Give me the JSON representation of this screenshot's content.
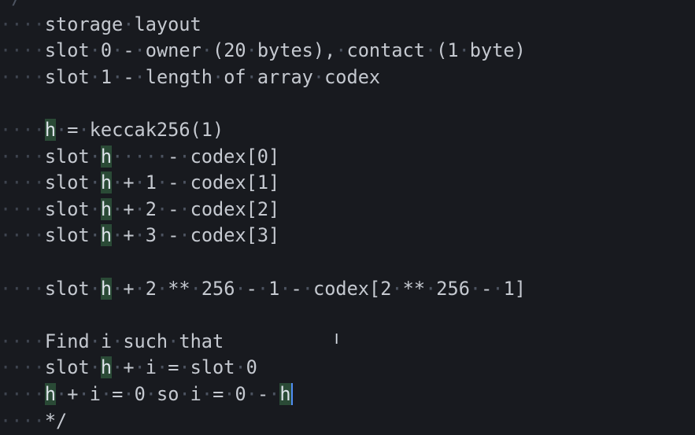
{
  "editor": {
    "lines": [
      {
        "id": "top",
        "indent": "",
        "segments": [
          {
            "t": " ",
            "k": "code"
          },
          {
            "t": "/",
            "k": "ws"
          }
        ]
      },
      {
        "id": "l1",
        "indent": "····",
        "segments": [
          {
            "t": "storage",
            "k": "code"
          },
          {
            "t": "·",
            "k": "ws"
          },
          {
            "t": "layout",
            "k": "code"
          }
        ]
      },
      {
        "id": "l2",
        "indent": "····",
        "segments": [
          {
            "t": "slot",
            "k": "code"
          },
          {
            "t": "·",
            "k": "ws"
          },
          {
            "t": "0",
            "k": "code"
          },
          {
            "t": "·",
            "k": "ws"
          },
          {
            "t": "-",
            "k": "code"
          },
          {
            "t": "·",
            "k": "ws"
          },
          {
            "t": "owner",
            "k": "code"
          },
          {
            "t": "·",
            "k": "ws"
          },
          {
            "t": "(20",
            "k": "code"
          },
          {
            "t": "·",
            "k": "ws"
          },
          {
            "t": "bytes),",
            "k": "code"
          },
          {
            "t": "·",
            "k": "ws"
          },
          {
            "t": "contact",
            "k": "code"
          },
          {
            "t": "·",
            "k": "ws"
          },
          {
            "t": "(1",
            "k": "code"
          },
          {
            "t": "·",
            "k": "ws"
          },
          {
            "t": "byte)",
            "k": "code"
          }
        ]
      },
      {
        "id": "l3",
        "indent": "····",
        "segments": [
          {
            "t": "slot",
            "k": "code"
          },
          {
            "t": "·",
            "k": "ws"
          },
          {
            "t": "1",
            "k": "code"
          },
          {
            "t": "·",
            "k": "ws"
          },
          {
            "t": "-",
            "k": "code"
          },
          {
            "t": "·",
            "k": "ws"
          },
          {
            "t": "length",
            "k": "code"
          },
          {
            "t": "·",
            "k": "ws"
          },
          {
            "t": "of",
            "k": "code"
          },
          {
            "t": "·",
            "k": "ws"
          },
          {
            "t": "array",
            "k": "code"
          },
          {
            "t": "·",
            "k": "ws"
          },
          {
            "t": "codex",
            "k": "code"
          }
        ]
      },
      {
        "id": "blank1",
        "indent": "",
        "segments": []
      },
      {
        "id": "l5",
        "indent": "····",
        "segments": [
          {
            "t": "h",
            "k": "hl"
          },
          {
            "t": "·",
            "k": "ws"
          },
          {
            "t": "=",
            "k": "code"
          },
          {
            "t": "·",
            "k": "ws"
          },
          {
            "t": "keccak256(1)",
            "k": "code"
          }
        ]
      },
      {
        "id": "l6",
        "indent": "····",
        "segments": [
          {
            "t": "slot",
            "k": "code"
          },
          {
            "t": "·",
            "k": "ws"
          },
          {
            "t": "h",
            "k": "hl"
          },
          {
            "t": "·····",
            "k": "ws"
          },
          {
            "t": "-",
            "k": "code"
          },
          {
            "t": "·",
            "k": "ws"
          },
          {
            "t": "codex[0]",
            "k": "code"
          }
        ]
      },
      {
        "id": "l7",
        "indent": "····",
        "segments": [
          {
            "t": "slot",
            "k": "code"
          },
          {
            "t": "·",
            "k": "ws"
          },
          {
            "t": "h",
            "k": "hl"
          },
          {
            "t": "·",
            "k": "ws"
          },
          {
            "t": "+",
            "k": "code"
          },
          {
            "t": "·",
            "k": "ws"
          },
          {
            "t": "1",
            "k": "code"
          },
          {
            "t": "·",
            "k": "ws"
          },
          {
            "t": "-",
            "k": "code"
          },
          {
            "t": "·",
            "k": "ws"
          },
          {
            "t": "codex[1]",
            "k": "code"
          }
        ]
      },
      {
        "id": "l8",
        "indent": "····",
        "segments": [
          {
            "t": "slot",
            "k": "code"
          },
          {
            "t": "·",
            "k": "ws"
          },
          {
            "t": "h",
            "k": "hl"
          },
          {
            "t": "·",
            "k": "ws"
          },
          {
            "t": "+",
            "k": "code"
          },
          {
            "t": "·",
            "k": "ws"
          },
          {
            "t": "2",
            "k": "code"
          },
          {
            "t": "·",
            "k": "ws"
          },
          {
            "t": "-",
            "k": "code"
          },
          {
            "t": "·",
            "k": "ws"
          },
          {
            "t": "codex[2]",
            "k": "code"
          }
        ]
      },
      {
        "id": "l9",
        "indent": "····",
        "segments": [
          {
            "t": "slot",
            "k": "code"
          },
          {
            "t": "·",
            "k": "ws"
          },
          {
            "t": "h",
            "k": "hl"
          },
          {
            "t": "·",
            "k": "ws"
          },
          {
            "t": "+",
            "k": "code"
          },
          {
            "t": "·",
            "k": "ws"
          },
          {
            "t": "3",
            "k": "code"
          },
          {
            "t": "·",
            "k": "ws"
          },
          {
            "t": "-",
            "k": "code"
          },
          {
            "t": "·",
            "k": "ws"
          },
          {
            "t": "codex[3]",
            "k": "code"
          }
        ]
      },
      {
        "id": "blank2",
        "indent": "",
        "segments": []
      },
      {
        "id": "l11",
        "indent": "····",
        "segments": [
          {
            "t": "slot",
            "k": "code"
          },
          {
            "t": "·",
            "k": "ws"
          },
          {
            "t": "h",
            "k": "hl"
          },
          {
            "t": "·",
            "k": "ws"
          },
          {
            "t": "+",
            "k": "code"
          },
          {
            "t": "·",
            "k": "ws"
          },
          {
            "t": "2",
            "k": "code"
          },
          {
            "t": "·",
            "k": "ws"
          },
          {
            "t": "**",
            "k": "code"
          },
          {
            "t": "·",
            "k": "ws"
          },
          {
            "t": "256",
            "k": "code"
          },
          {
            "t": "·",
            "k": "ws"
          },
          {
            "t": "-",
            "k": "code"
          },
          {
            "t": "·",
            "k": "ws"
          },
          {
            "t": "1",
            "k": "code"
          },
          {
            "t": "·",
            "k": "ws"
          },
          {
            "t": "-",
            "k": "code"
          },
          {
            "t": "·",
            "k": "ws"
          },
          {
            "t": "codex[2",
            "k": "code"
          },
          {
            "t": "·",
            "k": "ws"
          },
          {
            "t": "**",
            "k": "code"
          },
          {
            "t": "·",
            "k": "ws"
          },
          {
            "t": "256",
            "k": "code"
          },
          {
            "t": "·",
            "k": "ws"
          },
          {
            "t": "-",
            "k": "code"
          },
          {
            "t": "·",
            "k": "ws"
          },
          {
            "t": "1]",
            "k": "code"
          }
        ]
      },
      {
        "id": "blank3",
        "indent": "",
        "segments": []
      },
      {
        "id": "l13",
        "indent": "····",
        "segments": [
          {
            "t": "Find",
            "k": "code"
          },
          {
            "t": "·",
            "k": "ws"
          },
          {
            "t": "i",
            "k": "code"
          },
          {
            "t": "·",
            "k": "ws"
          },
          {
            "t": "such",
            "k": "code"
          },
          {
            "t": "·",
            "k": "ws"
          },
          {
            "t": "that",
            "k": "code"
          }
        ]
      },
      {
        "id": "l14",
        "indent": "····",
        "segments": [
          {
            "t": "slot",
            "k": "code"
          },
          {
            "t": "·",
            "k": "ws"
          },
          {
            "t": "h",
            "k": "hl"
          },
          {
            "t": "·",
            "k": "ws"
          },
          {
            "t": "+",
            "k": "code"
          },
          {
            "t": "·",
            "k": "ws"
          },
          {
            "t": "i",
            "k": "code"
          },
          {
            "t": "·",
            "k": "ws"
          },
          {
            "t": "=",
            "k": "code"
          },
          {
            "t": "·",
            "k": "ws"
          },
          {
            "t": "slot",
            "k": "code"
          },
          {
            "t": "·",
            "k": "ws"
          },
          {
            "t": "0",
            "k": "code"
          }
        ]
      },
      {
        "id": "l15",
        "indent": "····",
        "segments": [
          {
            "t": "h",
            "k": "hl"
          },
          {
            "t": "·",
            "k": "ws"
          },
          {
            "t": "+",
            "k": "code"
          },
          {
            "t": "·",
            "k": "ws"
          },
          {
            "t": "i",
            "k": "code"
          },
          {
            "t": "·",
            "k": "ws"
          },
          {
            "t": "=",
            "k": "code"
          },
          {
            "t": "·",
            "k": "ws"
          },
          {
            "t": "0",
            "k": "code"
          },
          {
            "t": "·",
            "k": "ws"
          },
          {
            "t": "so",
            "k": "code"
          },
          {
            "t": "·",
            "k": "ws"
          },
          {
            "t": "i",
            "k": "code"
          },
          {
            "t": "·",
            "k": "ws"
          },
          {
            "t": "=",
            "k": "code"
          },
          {
            "t": "·",
            "k": "ws"
          },
          {
            "t": "0",
            "k": "code"
          },
          {
            "t": "·",
            "k": "ws"
          },
          {
            "t": "-",
            "k": "code"
          },
          {
            "t": "·",
            "k": "ws"
          },
          {
            "t": "h",
            "k": "hl-cur"
          }
        ]
      },
      {
        "id": "l16",
        "indent": "····",
        "segments": [
          {
            "t": "*/",
            "k": "code"
          }
        ]
      }
    ],
    "colors": {
      "background": "#181a1f",
      "text": "#c5c9d0",
      "whitespace_dot": "#4c5360",
      "match_highlight": "#2a4a36",
      "cursor": "#4f8df5"
    },
    "mouse_cursor_icon": "ibeam-icon"
  }
}
